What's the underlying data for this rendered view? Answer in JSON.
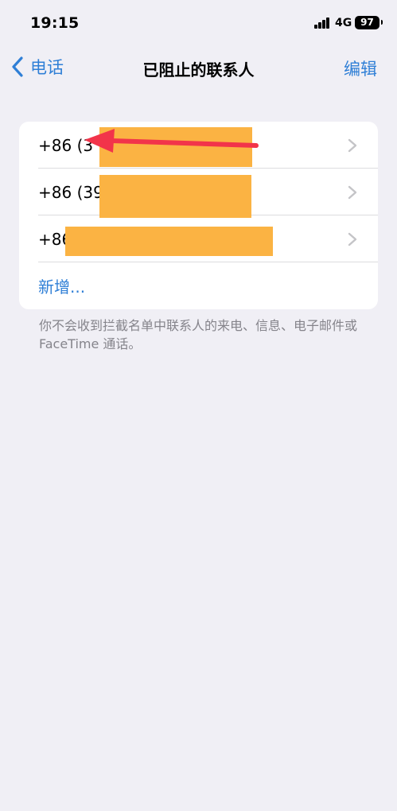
{
  "status_bar": {
    "time": "19:15",
    "network": "4G",
    "battery": "97"
  },
  "nav": {
    "back_label": "电话",
    "title": "已阻止的联系人",
    "edit_label": "编辑"
  },
  "blocked_list": {
    "items": [
      {
        "label": "+86 (3"
      },
      {
        "label": "+86 (39"
      },
      {
        "label": "+86"
      }
    ],
    "add_label": "新增..."
  },
  "footer_note": "你不会收到拦截名单中联系人的来电、信息、电子邮件或 FaceTime 通话。",
  "colors": {
    "accent": "#2f7fd6",
    "background": "#f0eff5",
    "redaction": "#fbb343",
    "annotation_arrow": "#f2344a"
  },
  "icons": {
    "back": "chevron-left-icon",
    "row_disclosure": "chevron-right-icon",
    "annotation": "red-arrow-annotation"
  }
}
